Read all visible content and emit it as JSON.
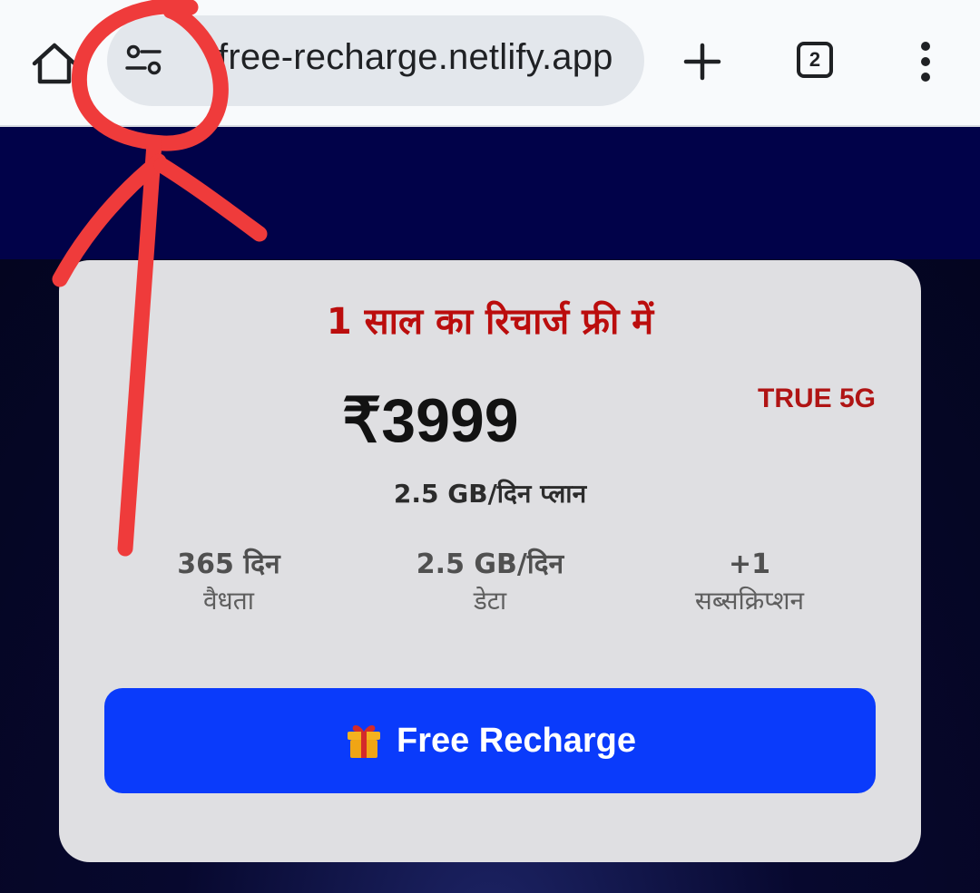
{
  "browser": {
    "url": "free-recharge.netlify.app",
    "tab_count": "2",
    "icons": [
      "home-icon",
      "site-settings-icon",
      "plus-icon",
      "tab-switcher-icon",
      "more-vert-icon"
    ]
  },
  "card": {
    "title": "1 साल का रिचार्ज फ्री में",
    "price": "₹3999",
    "badge": "TRUE 5G",
    "subtitle": "2.5 GB/दिन प्लान",
    "benefits": [
      {
        "value": "365 दिन",
        "label": "वैधता"
      },
      {
        "value": "2.5 GB/दिन",
        "label": "डेटा"
      },
      {
        "value": "+1",
        "label": "सब्सक्रिप्शन"
      }
    ],
    "cta": {
      "label": "Free Recharge",
      "icon": "gift-icon"
    }
  },
  "colors": {
    "title_red": "#bb0d0d",
    "badge_red": "#b01414",
    "cta_blue": "#0a3bfb",
    "card_bg": "#dfdfe2",
    "hero_band": "#010249",
    "annotation_red": "#ef3b3b"
  }
}
